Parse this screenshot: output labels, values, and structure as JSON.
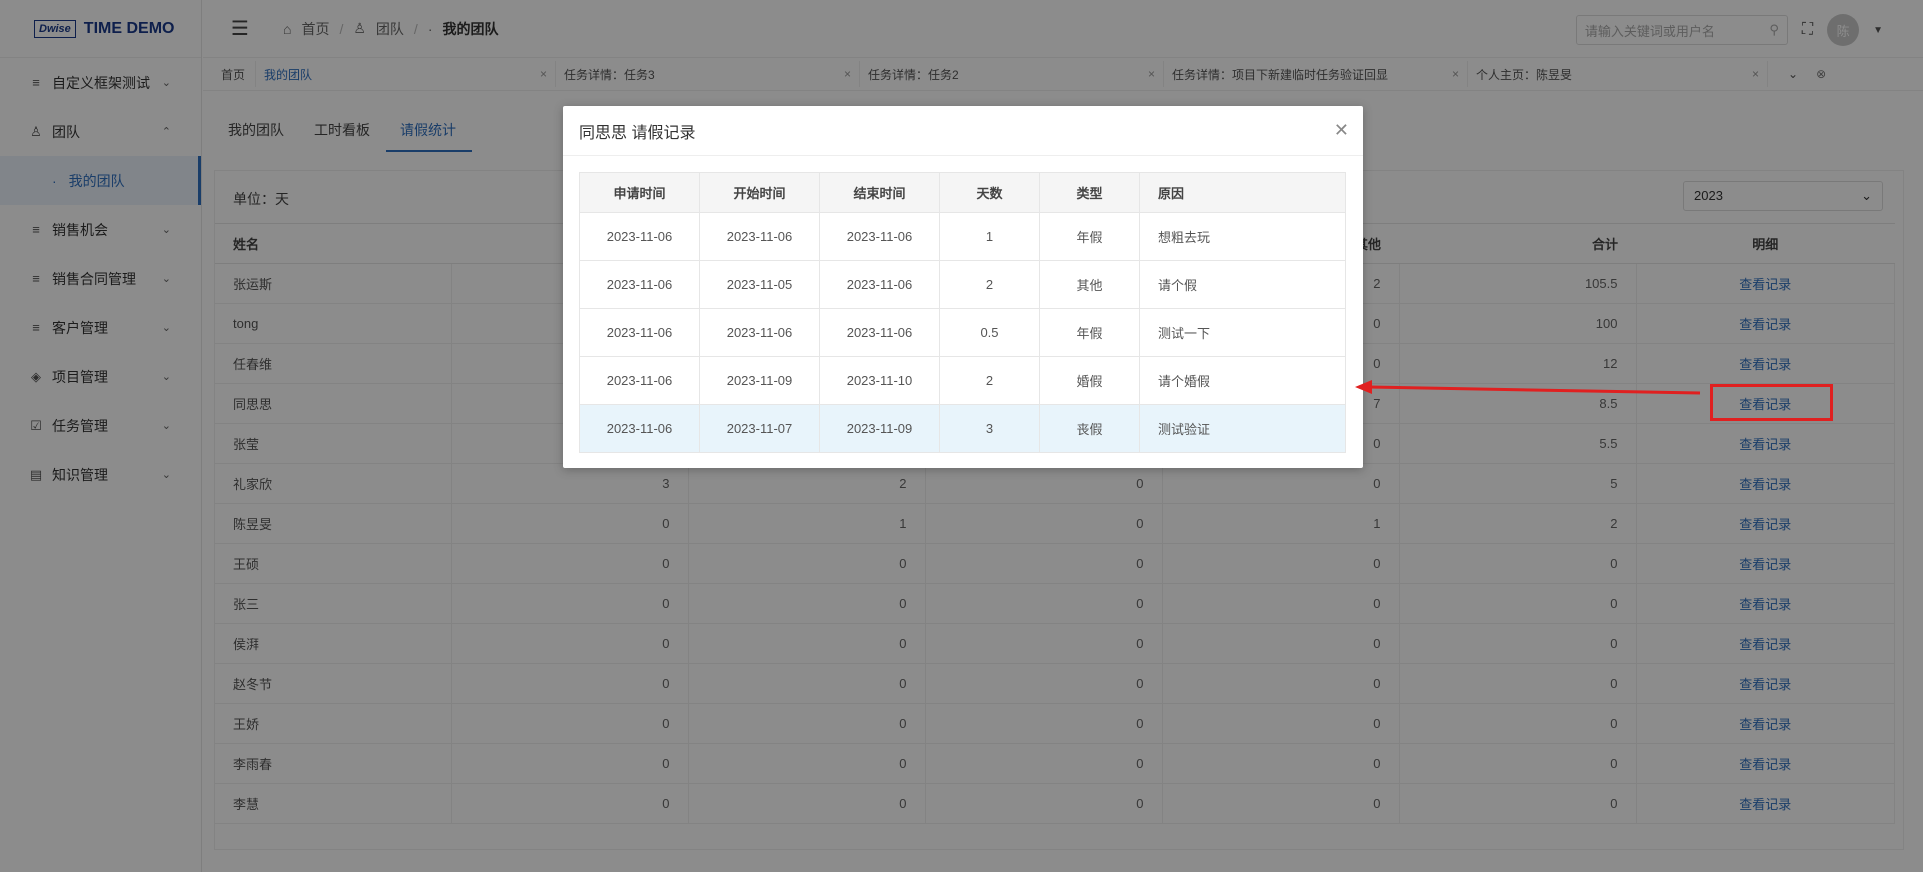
{
  "app": {
    "logo_mark": "Dwise",
    "logo_text": "TIME DEMO"
  },
  "sidebar": {
    "items": [
      {
        "label": "自定义框架测试",
        "icon": "list-icon"
      },
      {
        "label": "团队",
        "icon": "team-icon"
      },
      {
        "label": "销售机会",
        "icon": "list-icon"
      },
      {
        "label": "销售合同管理",
        "icon": "list-icon"
      },
      {
        "label": "客户管理",
        "icon": "list-icon"
      },
      {
        "label": "项目管理",
        "icon": "layers-icon"
      },
      {
        "label": "任务管理",
        "icon": "checkbox-icon"
      },
      {
        "label": "知识管理",
        "icon": "book-icon"
      }
    ],
    "sub_active": "我的团队"
  },
  "header": {
    "breadcrumb": [
      "首页",
      "团队",
      "我的团队"
    ],
    "search_placeholder": "请输入关键词或用户名",
    "avatar_text": "陈"
  },
  "tabs": [
    {
      "label": "首页"
    },
    {
      "label": "我的团队"
    },
    {
      "label": "任务详情：任务3"
    },
    {
      "label": "任务详情：任务2"
    },
    {
      "label": "任务详情：项目下新建临时任务验证回显"
    },
    {
      "label": "个人主页：陈昱旻"
    }
  ],
  "subtabs": [
    "我的团队",
    "工时看板",
    "请假统计"
  ],
  "content": {
    "unit": "单位：天",
    "year": "2023",
    "columns": {
      "name": "姓名",
      "other": "其他",
      "total": "合计",
      "detail": "明细"
    },
    "link_label": "查看记录",
    "rows": [
      {
        "name": "张运斯",
        "c1": "",
        "c2": "",
        "c3": "",
        "other": "2",
        "total": "105.5"
      },
      {
        "name": "tong",
        "c1": "",
        "c2": "",
        "c3": "",
        "other": "0",
        "total": "100"
      },
      {
        "name": "任春维",
        "c1": "",
        "c2": "",
        "c3": "",
        "other": "0",
        "total": "12"
      },
      {
        "name": "同思思",
        "c1": "",
        "c2": "",
        "c3": "",
        "other": "7",
        "total": "8.5"
      },
      {
        "name": "张莹",
        "c1": "",
        "c2": "",
        "c3": "",
        "other": "0",
        "total": "5.5"
      },
      {
        "name": "礼家欣",
        "c1": "3",
        "c2": "2",
        "c3": "0",
        "other": "0",
        "total": "5"
      },
      {
        "name": "陈昱旻",
        "c1": "0",
        "c2": "1",
        "c3": "0",
        "other": "1",
        "total": "2"
      },
      {
        "name": "王硕",
        "c1": "0",
        "c2": "0",
        "c3": "0",
        "other": "0",
        "total": "0"
      },
      {
        "name": "张三",
        "c1": "0",
        "c2": "0",
        "c3": "0",
        "other": "0",
        "total": "0"
      },
      {
        "name": "侯湃",
        "c1": "0",
        "c2": "0",
        "c3": "0",
        "other": "0",
        "total": "0"
      },
      {
        "name": "赵冬节",
        "c1": "0",
        "c2": "0",
        "c3": "0",
        "other": "0",
        "total": "0"
      },
      {
        "name": "王娇",
        "c1": "0",
        "c2": "0",
        "c3": "0",
        "other": "0",
        "total": "0"
      },
      {
        "name": "李雨春",
        "c1": "0",
        "c2": "0",
        "c3": "0",
        "other": "0",
        "total": "0"
      },
      {
        "name": "李慧",
        "c1": "0",
        "c2": "0",
        "c3": "0",
        "other": "0",
        "total": "0"
      }
    ]
  },
  "dialog": {
    "title": "同思思 请假记录",
    "headers": [
      "申请时间",
      "开始时间",
      "结束时间",
      "天数",
      "类型",
      "原因"
    ],
    "records": [
      [
        "2023-11-06",
        "2023-11-06",
        "2023-11-06",
        "1",
        "年假",
        "想粗去玩"
      ],
      [
        "2023-11-06",
        "2023-11-05",
        "2023-11-06",
        "2",
        "其他",
        "请个假"
      ],
      [
        "2023-11-06",
        "2023-11-06",
        "2023-11-06",
        "0.5",
        "年假",
        "测试一下"
      ],
      [
        "2023-11-06",
        "2023-11-09",
        "2023-11-10",
        "2",
        "婚假",
        "请个婚假"
      ],
      [
        "2023-11-06",
        "2023-11-07",
        "2023-11-09",
        "3",
        "丧假",
        "测试验证"
      ]
    ]
  },
  "colors": {
    "accent": "#2f6fbf",
    "annotation": "#e02020"
  }
}
